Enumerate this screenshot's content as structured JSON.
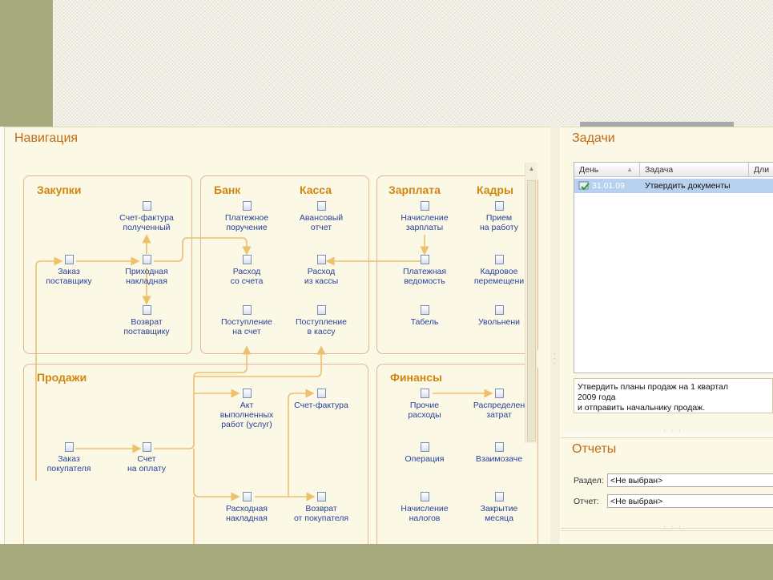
{
  "navigation": {
    "title": "Навигация",
    "sections": {
      "purchases": "Закупки",
      "bank": "Банк",
      "cash": "Касса",
      "salary": "Зарплата",
      "hr": "Кадры",
      "sales": "Продажи",
      "finance": "Финансы"
    },
    "docs": {
      "invoice_received": [
        "Счет-фактура",
        "полученный"
      ],
      "supplier_order": [
        "Заказ",
        "поставщику"
      ],
      "purchase_invoice": [
        "Приходная",
        "накладная"
      ],
      "supplier_return": [
        "Возврат",
        "поставщику"
      ],
      "payment_order": [
        "Платежное",
        "поручение"
      ],
      "advance_report": [
        "Авансовый",
        "отчет"
      ],
      "account_expense": [
        "Расход",
        "со счета"
      ],
      "cash_expense": [
        "Расход",
        "из кассы"
      ],
      "account_receipt": [
        "Поступление",
        "на счет"
      ],
      "cash_receipt": [
        "Поступление",
        "в кассу"
      ],
      "salary_accrual": [
        "Начисление",
        "зарплаты"
      ],
      "payroll": [
        "Платежная",
        "ведомость"
      ],
      "timesheet": [
        "Табель"
      ],
      "hiring": [
        "Прием",
        "на работу"
      ],
      "transfer": [
        "Кадровое",
        "перемещени"
      ],
      "dismissal": [
        "Увольнени"
      ],
      "customer_order": [
        "Заказ",
        "покупателя"
      ],
      "payment_invoice": [
        "Счет",
        "на оплату"
      ],
      "work_act": [
        "Акт",
        "выполненных",
        "работ (услуг)"
      ],
      "sales_invoice": [
        "Счет-фактура"
      ],
      "sales_waybill": [
        "Расходная",
        "накладная"
      ],
      "customer_return": [
        "Возврат",
        "от покупателя"
      ],
      "other_expenses": [
        "Прочие",
        "расходы"
      ],
      "cost_distribution": [
        "Распределен",
        "затрат"
      ],
      "operation": [
        "Операция"
      ],
      "mutual_offset": [
        "Взаимозаче"
      ],
      "tax_accrual": [
        "Начисление",
        "налогов"
      ],
      "month_close": [
        "Закрытие",
        "месяца"
      ]
    }
  },
  "tasks": {
    "title": "Задачи",
    "columns": [
      "День",
      "Задача",
      "Дли"
    ],
    "rows": [
      {
        "day": "31.01.09",
        "task": "Утвердить документы"
      }
    ],
    "description": [
      "Утвердить планы продаж на 1 квартал",
      "2009 года",
      "и отправить начальнику продаж."
    ]
  },
  "reports": {
    "title": "Отчеты",
    "section_label": "Раздел:",
    "section_value": "<Не выбран>",
    "report_label": "Отчет:",
    "report_value": "<Не выбран>"
  },
  "colors": {
    "accent": "#c06b13",
    "section_title": "#d1860f",
    "link": "#28419a",
    "arrow": "#ecc16e",
    "frame": "#a7aa7c"
  }
}
